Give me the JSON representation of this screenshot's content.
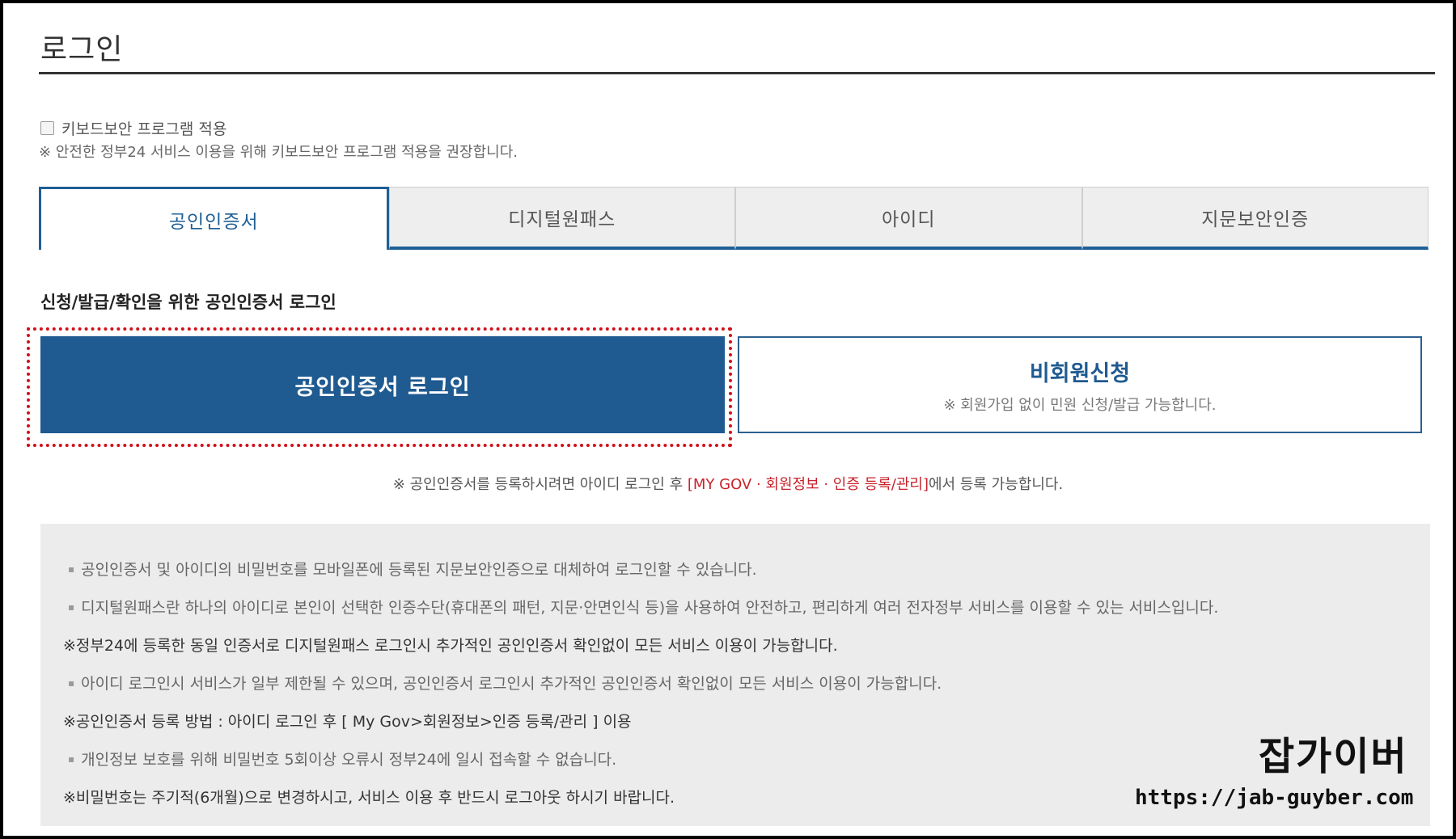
{
  "page": {
    "title": "로그인"
  },
  "keyboard_security": {
    "checkbox_label": "키보드보안 프로그램 적용",
    "checked": false,
    "note": "※ 안전한 정부24 서비스 이용을 위해 키보드보안 프로그램 적용을 권장합니다."
  },
  "tabs": [
    {
      "label": "공인인증서",
      "active": true
    },
    {
      "label": "디지털원패스",
      "active": false
    },
    {
      "label": "아이디",
      "active": false
    },
    {
      "label": "지문보안인증",
      "active": false
    }
  ],
  "cert_section": {
    "heading": "신청/발급/확인을 위한 공인인증서 로그인",
    "login_button": "공인인증서 로그인",
    "nonmember_title": "비회원신청",
    "nonmember_sub": "※ 회원가입 없이 민원 신청/발급 가능합니다."
  },
  "register_note": {
    "prefix": "※ 공인인증서를 등록하시려면 아이디 로그인 후 ",
    "link": "[MY GOV · 회원정보 · 인증 등록/관리]",
    "suffix": "에서 등록 가능합니다."
  },
  "info_lines": [
    {
      "type": "bullet",
      "text": "공인인증서 및 아이디의 비밀번호를 모바일폰에 등록된 지문보안인증으로 대체하여 로그인할 수 있습니다."
    },
    {
      "type": "bullet",
      "text": "디지털원패스란 하나의 아이디로 본인이 선택한 인증수단(휴대폰의 패턴, 지문·안면인식 등)을 사용하여 안전하고, 편리하게 여러 전자정부 서비스를 이용할 수 있는 서비스입니다."
    },
    {
      "type": "note",
      "text": "※정부24에 등록한 동일 인증서로 디지털원패스 로그인시 추가적인 공인인증서 확인없이 모든 서비스 이용이 가능합니다."
    },
    {
      "type": "bullet",
      "text": "아이디 로그인시 서비스가 일부 제한될 수 있으며, 공인인증서 로그인시 추가적인 공인인증서 확인없이 모든 서비스 이용이 가능합니다."
    },
    {
      "type": "note",
      "text": "※공인인증서 등록 방법 : 아이디 로그인 후 [ My Gov>회원정보>인증 등록/관리 ] 이용"
    },
    {
      "type": "bullet",
      "text": "개인정보 보호를 위해 비밀번호 5회이상 오류시 정부24에 일시 접속할 수 없습니다."
    },
    {
      "type": "note",
      "text": "※비밀번호는 주기적(6개월)으로 변경하시고, 서비스 이용 후 반드시 로그아웃 하시기 바랍니다."
    }
  ],
  "watermark": {
    "title": "잡가이버",
    "url": "https://jab-guyber.com"
  },
  "colors": {
    "primary": "#1f5a91",
    "highlight_red": "#d0111a",
    "link_red": "#c8232c",
    "info_bg": "#ececec"
  }
}
